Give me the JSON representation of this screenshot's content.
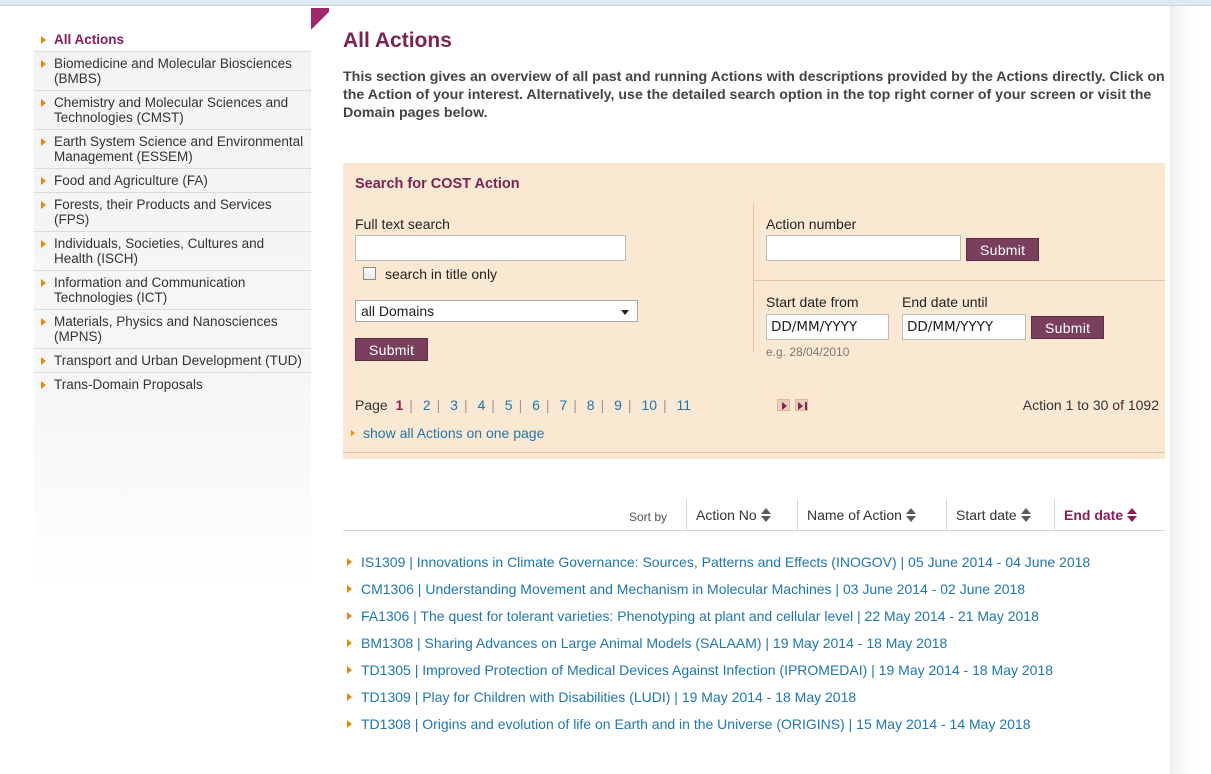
{
  "sidebar": {
    "items": [
      {
        "label": "All Actions",
        "active": true
      },
      {
        "label": "Biomedicine and Molecular Biosciences (BMBS)"
      },
      {
        "label": "Chemistry and Molecular Sciences and Technologies (CMST)"
      },
      {
        "label": "Earth System Science and Environmental Management (ESSEM)"
      },
      {
        "label": "Food and Agriculture (FA)"
      },
      {
        "label": "Forests, their Products and Services (FPS)"
      },
      {
        "label": "Individuals, Societies, Cultures and Health (ISCH)"
      },
      {
        "label": "Information and Communication Technologies (ICT)"
      },
      {
        "label": "Materials, Physics and Nanosciences (MPNS)"
      },
      {
        "label": "Transport and Urban Development (TUD)"
      },
      {
        "label": "Trans-Domain Proposals"
      }
    ]
  },
  "main": {
    "title": "All Actions",
    "intro": "This section gives an overview of all past and running Actions with descriptions provided by the Actions directly. Click on the Action of your interest. Alternatively, use the detailed search option in the top right corner of your screen or visit the Domain pages below."
  },
  "search": {
    "title": "Search for COST Action",
    "full_text_label": "Full text search",
    "full_text_value": "",
    "title_only_label": "search in title only",
    "domain_selected": "all Domains",
    "submit_label": "Submit",
    "action_number_label": "Action number",
    "action_number_value": "",
    "start_date_label": "Start date from",
    "end_date_label": "End date until",
    "start_date_value": "DD/MM/YYYY",
    "end_date_value": "DD/MM/YYYY",
    "date_hint": "e.g. 28/04/2010"
  },
  "pager": {
    "label": "Page",
    "pages": [
      "1",
      "2",
      "3",
      "4",
      "5",
      "6",
      "7",
      "8",
      "9",
      "10",
      "11"
    ],
    "current": "1",
    "count_text": "Action 1 to 30 of 1092",
    "show_all": "show all Actions on one page"
  },
  "sort": {
    "label": "Sort by",
    "columns": [
      {
        "label": "Action No",
        "active": false
      },
      {
        "label": "Name of Action",
        "active": false
      },
      {
        "label": "Start date",
        "active": false
      },
      {
        "label": "End date",
        "active": true
      }
    ]
  },
  "results": [
    "IS1309 | Innovations in Climate Governance: Sources, Patterns and Effects (INOGOV) | 05 June 2014 - 04 June 2018",
    "CM1306 | Understanding Movement and Mechanism in Molecular Machines | 03 June 2014 - 02 June 2018",
    "FA1306 | The quest for tolerant varieties: Phenotyping at plant and cellular level | 22 May 2014 - 21 May 2018",
    "BM1308 | Sharing Advances on Large Animal Models (SALAAM) | 19 May 2014 - 18 May 2018",
    "TD1305 | Improved Protection of Medical Devices Against Infection (IPROMEDAI) | 19 May 2014 - 18 May 2018",
    "TD1309 | Play for Children with Disabilities (LUDI) | 19 May 2014 - 18 May 2018",
    "TD1308 | Origins and evolution of life on Earth and in the Universe (ORIGINS) | 15 May 2014 - 14 May 2018"
  ],
  "colors": {
    "accent": "#7a2452",
    "link": "#1e77b0",
    "panel": "#fbe8d2",
    "button": "#7a3f5c",
    "bullet": "#e08a14"
  }
}
